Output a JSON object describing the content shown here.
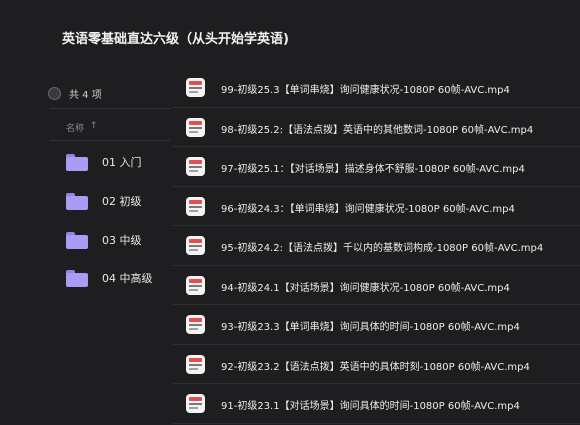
{
  "header": {
    "title": "英语零基础直达六级（从头开始学英语)"
  },
  "sidebar": {
    "count_text": "共 4 项",
    "sort_label": "名称",
    "sort_arrow": "↑",
    "folders": [
      {
        "label": "01 入门"
      },
      {
        "label": "02 初级"
      },
      {
        "label": "03 中级"
      },
      {
        "label": "04 中高级"
      }
    ]
  },
  "files": [
    {
      "name": "99-初级25.3【单词串烧】询问健康状况-1080P 60帧-AVC.mp4"
    },
    {
      "name": "98-初级25.2:【语法点拨】英语中的其他数词-1080P 60帧-AVC.mp4"
    },
    {
      "name": "97-初级25.1：【对话场景】描述身体不舒服-1080P 60帧-AVC.mp4"
    },
    {
      "name": "96-初级24.3：【单词串烧】询问健康状况-1080P 60帧-AVC.mp4"
    },
    {
      "name": "95-初级24.2:【语法点拨】千以内的基数词构成-1080P 60帧-AVC.mp4"
    },
    {
      "name": "94-初级24.1【对话场景】询问健康状况-1080P 60帧-AVC.mp4"
    },
    {
      "name": "93-初级23.3【单词串烧】询问具体的时间-1080P 60帧-AVC.mp4"
    },
    {
      "name": "92-初级23.2【语法点拨】英语中的具体时刻-1080P 60帧-AVC.mp4"
    },
    {
      "name": "91-初级23.1【对话场景】询问具体的时间-1080P 60帧-AVC.mp4"
    }
  ]
}
